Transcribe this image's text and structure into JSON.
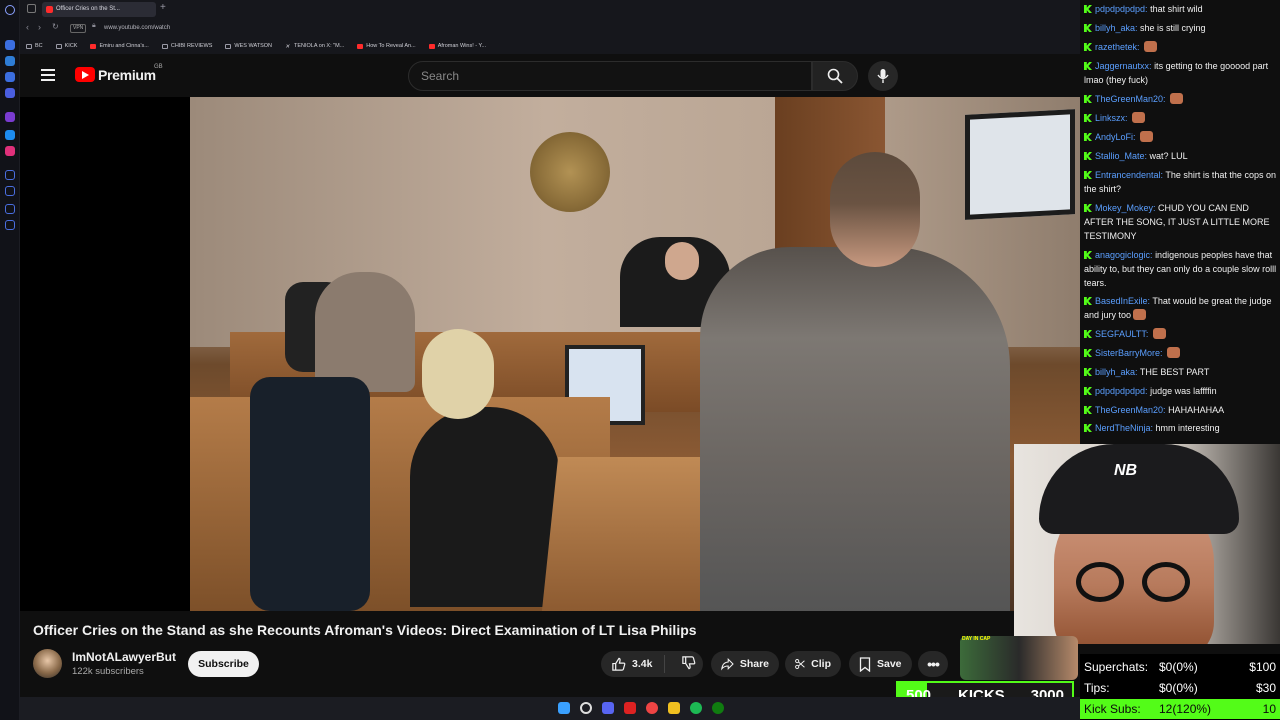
{
  "browser": {
    "tab_title": "Officer Cries on the St...",
    "url": "www.youtube.com/watch",
    "vpn_label": "VPN",
    "bookmarks": [
      "BC",
      "KICK",
      "Emiru and Cinna's...",
      "CHIBI REVIEWS",
      "WES WATSON",
      "TENIOLA on X: \"M...",
      "How To Reveal An...",
      "Afroman Wins! - Y..."
    ]
  },
  "youtube": {
    "brand": "Premium",
    "region": "GB",
    "search_placeholder": "Search",
    "video_title": "Officer Cries on the Stand as she Recounts Afroman's Videos: Direct Examination of LT Lisa Philips",
    "channel_name": "ImNotALawyerBut",
    "subscribers": "122k subscribers",
    "subscribe_label": "Subscribe",
    "likes": "3.4k",
    "share_label": "Share",
    "clip_label": "Clip",
    "save_label": "Save"
  },
  "chat": [
    {
      "user": "pdpdpdpdpd:",
      "text": "that shirt wild",
      "emote": false
    },
    {
      "user": "billyh_aka:",
      "text": "she is still crying",
      "emote": false
    },
    {
      "user": "razethetek:",
      "text": "",
      "emote": true
    },
    {
      "user": "Jaggernautxx:",
      "text": "its getting to the gooood part lmao (they fuck)",
      "emote": false
    },
    {
      "user": "TheGreenMan20:",
      "text": "",
      "emote": true
    },
    {
      "user": "Linkszx:",
      "text": "",
      "emote": true
    },
    {
      "user": "AndyLoFi:",
      "text": "",
      "emote": true
    },
    {
      "user": "Stallio_Mate:",
      "text": "wat? LUL",
      "emote": false
    },
    {
      "user": "Entrancendental:",
      "text": "The shirt is that the cops on the shirt?",
      "emote": false
    },
    {
      "user": "Mokey_Mokey:",
      "text": "CHUD YOU CAN END AFTER THE SONG, IT JUST A LITTLE MORE TESTIMONY",
      "emote": false
    },
    {
      "user": "anagogiclogic:",
      "text": "indigenous peoples have that ability to, but they can only do a couple slow rolll tears.",
      "emote": false
    },
    {
      "user": "BasedInExile:",
      "text": "That would be great the judge and jury too",
      "emote": true
    },
    {
      "user": "SEGFAULTT:",
      "text": "",
      "emote": true
    },
    {
      "user": "SisterBarryMore:",
      "text": "",
      "emote": true
    },
    {
      "user": "billyh_aka:",
      "text": "THE BEST PART",
      "emote": false
    },
    {
      "user": "pdpdpdpdpd:",
      "text": "judge was laffffin",
      "emote": false
    },
    {
      "user": "TheGreenMan20:",
      "text": "HAHAHAHAA",
      "emote": false
    },
    {
      "user": "NerdTheNinja:",
      "text": "hmm interesting",
      "emote": false
    }
  ],
  "overlay": {
    "cap_logo": "NB",
    "sticker_text": "DAY IN CAP",
    "kicks_current": "500",
    "kicks_label": "KICKS",
    "kicks_goal": "3000",
    "kicks_progress": 0.1667
  },
  "stats": [
    {
      "label": "Superchats:",
      "value": "$0(0%)",
      "goal": "$100"
    },
    {
      "label": "Tips:",
      "value": "$0(0%)",
      "goal": "$30"
    },
    {
      "label": "Kick Subs:",
      "value": "12(120%)",
      "goal": "10"
    }
  ],
  "colors": {
    "kick_green": "#53fc18",
    "youtube_red": "#ff0000",
    "chat_username": "#5b9fff"
  }
}
